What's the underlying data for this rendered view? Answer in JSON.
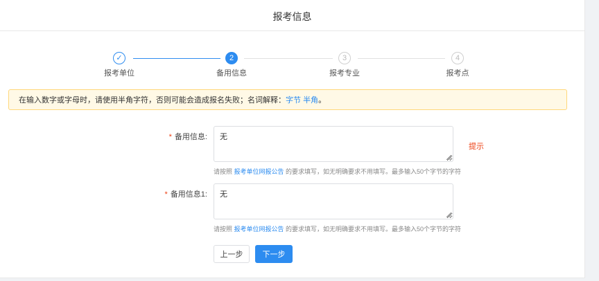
{
  "header": {
    "title": "报考信息"
  },
  "steps": [
    {
      "number": "✓",
      "label": "报考单位",
      "state": "done"
    },
    {
      "number": "2",
      "label": "备用信息",
      "state": "active"
    },
    {
      "number": "3",
      "label": "报考专业",
      "state": "todo"
    },
    {
      "number": "4",
      "label": "报考点",
      "state": "todo"
    }
  ],
  "alert": {
    "text": "在输入数字或字母时，请使用半角字符，否则可能会造成报名失败；名词解释：",
    "link1": "字节",
    "link2": "半角",
    "end": "。"
  },
  "fields": [
    {
      "label": "备用信息:",
      "value": "无",
      "help_prefix": "请按照 ",
      "help_link": "报考单位网报公告",
      "help_suffix": " 的要求填写，如无明确要求不用填写。最多输入50个字节的字符",
      "hint": "提示"
    },
    {
      "label": "备用信息1:",
      "value": "无",
      "help_prefix": "请按照 ",
      "help_link": "报考单位网报公告",
      "help_suffix": " 的要求填写，如无明确要求不用填写。最多输入50个字节的字符"
    }
  ],
  "buttons": {
    "prev": "上一步",
    "next": "下一步"
  },
  "colors": {
    "primary": "#2d8cf0",
    "required": "#ed4014",
    "alert_bg": "#fff9e6",
    "alert_border": "#ffd77a"
  }
}
